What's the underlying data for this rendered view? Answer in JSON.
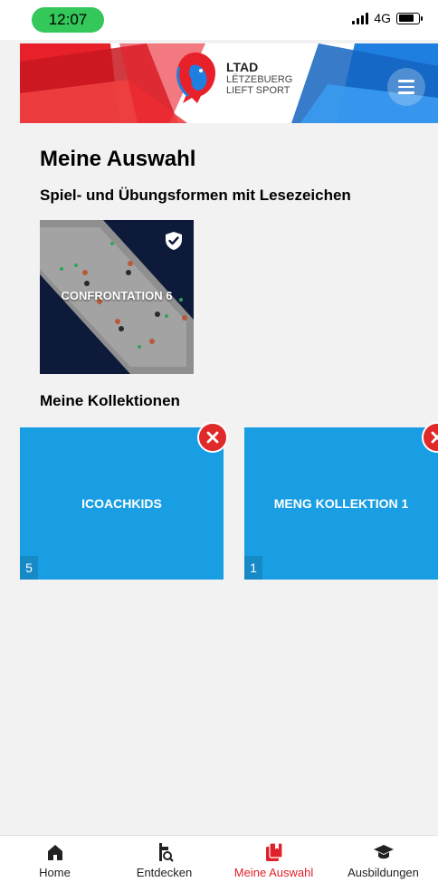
{
  "status_bar": {
    "time": "12:07",
    "network": "4G",
    "battery_level": 0.8
  },
  "header": {
    "logo_title": "LTAD",
    "logo_line2": "LËTZEBUERG",
    "logo_line3": "LIEFT SPORT",
    "menu_icon": "hamburger-menu-icon",
    "colors": {
      "red": "#e8202a",
      "blue": "#1f7fe0"
    }
  },
  "main": {
    "title": "Meine Auswahl",
    "bookmarks_heading": "Spiel- und Übungsformen mit Lesezeichen",
    "bookmark_cards": [
      {
        "label": "CONFRONTATION 6",
        "icon": "shield-check-icon"
      }
    ],
    "collections_heading": "Meine Kollektionen",
    "collections": [
      {
        "label": "ICOACHKIDS",
        "count": "5"
      },
      {
        "label": "MENG KOLLEKTION 1",
        "count": "1"
      }
    ],
    "collection_color": "#1a9ee3",
    "remove_color": "#e02a2a"
  },
  "bottom_nav": {
    "items": [
      {
        "label": "Home",
        "icon": "home-icon"
      },
      {
        "label": "Entdecken",
        "icon": "discover-icon"
      },
      {
        "label": "Meine Auswahl",
        "icon": "bookmark-icon",
        "active": true
      },
      {
        "label": "Ausbildungen",
        "icon": "graduation-cap-icon"
      }
    ],
    "active_color": "#e0202a"
  }
}
